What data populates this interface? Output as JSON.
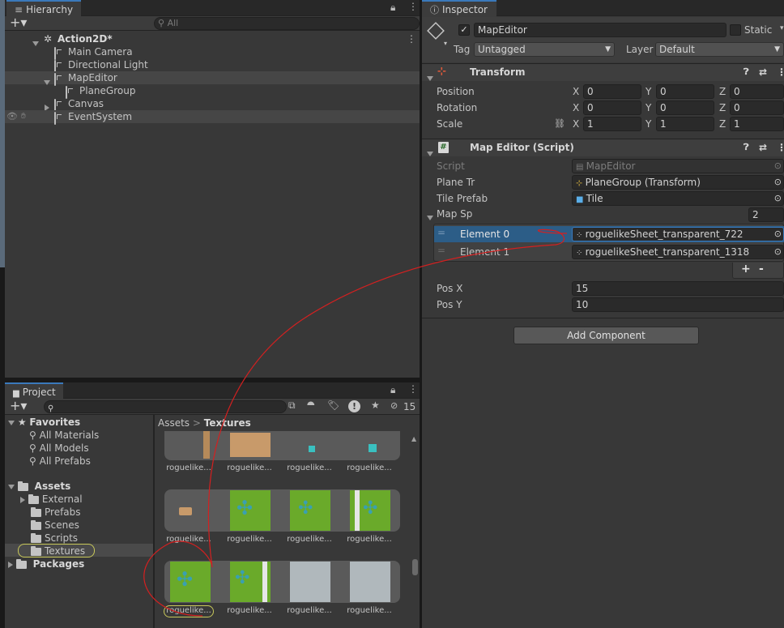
{
  "hierarchy": {
    "tab_label": "Hierarchy",
    "search_placeholder": "All",
    "scene": "Action2D*",
    "items": [
      "Main Camera",
      "Directional Light",
      "MapEditor",
      "PlaneGroup",
      "Canvas",
      "EventSystem"
    ]
  },
  "inspector": {
    "tab_label": "Inspector",
    "object_name": "MapEditor",
    "static_label": "Static",
    "tag_label": "Tag",
    "tag_value": "Untagged",
    "layer_label": "Layer",
    "layer_value": "Default",
    "transform": {
      "title": "Transform",
      "position_label": "Position",
      "rotation_label": "Rotation",
      "scale_label": "Scale",
      "x": "X",
      "y": "Y",
      "z": "Z",
      "position": [
        "0",
        "0",
        "0"
      ],
      "rotation": [
        "0",
        "0",
        "0"
      ],
      "scale": [
        "1",
        "1",
        "1"
      ]
    },
    "script": {
      "title": "Map Editor (Script)",
      "script_label": "Script",
      "script_value": "MapEditor",
      "plane_label": "Plane Tr",
      "plane_value": "PlaneGroup (Transform)",
      "tile_label": "Tile Prefab",
      "tile_value": "Tile",
      "map_label": "Map Sp",
      "map_count": "2",
      "element0_label": "Element 0",
      "element0_value": "roguelikeSheet_transparent_722",
      "element1_label": "Element 1",
      "element1_value": "roguelikeSheet_transparent_1318",
      "plus": "+",
      "minus": "-",
      "posx_label": "Pos X",
      "posx_value": "15",
      "posy_label": "Pos Y",
      "posy_value": "10"
    },
    "add_component": "Add Component"
  },
  "project": {
    "tab_label": "Project",
    "hidden_count": "15",
    "favorites_label": "Favorites",
    "favorites": [
      "All Materials",
      "All Models",
      "All Prefabs"
    ],
    "assets_label": "Assets",
    "folders": [
      "External",
      "Prefabs",
      "Scenes",
      "Scripts",
      "Textures"
    ],
    "packages_label": "Packages",
    "breadcrumb_root": "Assets",
    "breadcrumb_sep": ">",
    "breadcrumb_current": "Textures",
    "thumb_caption": "roguelike..."
  },
  "colors": {
    "selection": "#2c5d87",
    "accent_tab": "#3a79bb",
    "annotation_red": "#d42020",
    "highlight_yellow": "#c8c85a",
    "grass": "#6aaa2a"
  }
}
